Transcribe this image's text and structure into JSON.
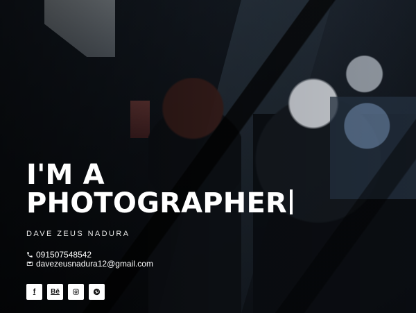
{
  "hero": {
    "title_line_1": "I'M A",
    "title_line_2": "PHOTOGRAPHER",
    "name": "DAVE ZEUS NADURA",
    "phone": "091507548542",
    "email": "davezeusnadura12@gmail.com"
  },
  "socials": {
    "facebook": "f",
    "behance": "Bē",
    "instagram": "instagram-icon",
    "pinterest": "pinterest-icon"
  },
  "colors": {
    "text": "#ffffff",
    "subtext": "#e8e8e8",
    "button_bg": "#ffffff",
    "button_text": "#111111"
  }
}
